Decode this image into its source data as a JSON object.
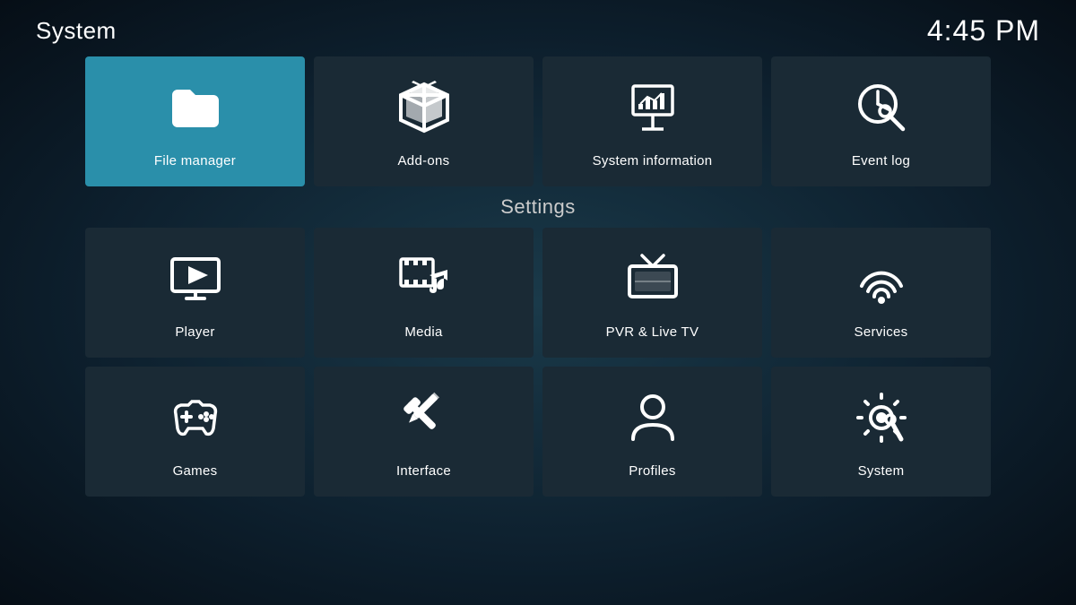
{
  "header": {
    "title": "System",
    "time": "4:45 PM"
  },
  "top_row": [
    {
      "id": "file-manager",
      "label": "File manager",
      "icon": "folder",
      "active": true
    },
    {
      "id": "add-ons",
      "label": "Add-ons",
      "icon": "box",
      "active": false
    },
    {
      "id": "system-information",
      "label": "System information",
      "icon": "projector",
      "active": false
    },
    {
      "id": "event-log",
      "label": "Event log",
      "icon": "clock-search",
      "active": false
    }
  ],
  "settings": {
    "label": "Settings",
    "rows": [
      [
        {
          "id": "player",
          "label": "Player",
          "icon": "monitor-play"
        },
        {
          "id": "media",
          "label": "Media",
          "icon": "film-music"
        },
        {
          "id": "pvr-live-tv",
          "label": "PVR & Live TV",
          "icon": "tv"
        },
        {
          "id": "services",
          "label": "Services",
          "icon": "podcast"
        }
      ],
      [
        {
          "id": "games",
          "label": "Games",
          "icon": "gamepad"
        },
        {
          "id": "interface",
          "label": "Interface",
          "icon": "tools"
        },
        {
          "id": "profiles",
          "label": "Profiles",
          "icon": "person"
        },
        {
          "id": "system",
          "label": "System",
          "icon": "gear-tools"
        }
      ]
    ]
  }
}
